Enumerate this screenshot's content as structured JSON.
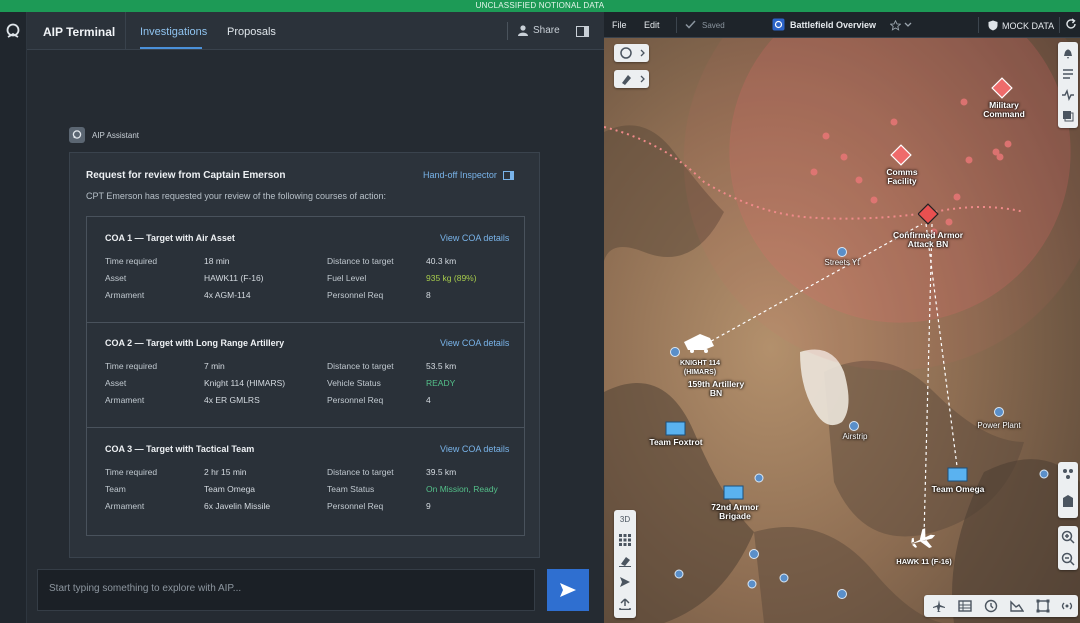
{
  "banner": "UNCLASSIFIED NOTIONAL DATA",
  "app": {
    "title": "AIP Terminal",
    "tabs": [
      "Investigations",
      "Proposals"
    ],
    "share": "Share"
  },
  "assistant": {
    "name": "AIP Assistant"
  },
  "request": {
    "title": "Request for review from Captain Emerson",
    "subtitle": "CPT Emerson has requested your review of the following courses of action:",
    "handoff": "Hand-off Inspector"
  },
  "coas": [
    {
      "title": "COA 1 — Target with Air Asset",
      "link": "View COA details",
      "rows": [
        [
          "Time required",
          "18 min",
          "Distance to target",
          "40.3 km"
        ],
        [
          "Asset",
          "HAWK11 (F-16)",
          "Fuel Level",
          "935 kg (89%)"
        ],
        [
          "Armament",
          "4x AGM-114",
          "Personnel Req",
          "8"
        ]
      ]
    },
    {
      "title": "COA 2 — Target with Long Range Artillery",
      "link": "View COA details",
      "rows": [
        [
          "Time required",
          "7 min",
          "Distance to target",
          "53.5 km"
        ],
        [
          "Asset",
          "Knight 114 (HIMARS)",
          "Vehicle Status",
          "READY"
        ],
        [
          "Armament",
          "4x ER GMLRS",
          "Personnel Req",
          "4"
        ]
      ]
    },
    {
      "title": "COA 3 — Target with Tactical Team",
      "link": "View COA details",
      "rows": [
        [
          "Time required",
          "2 hr 15 min",
          "Distance to target",
          "39.5 km"
        ],
        [
          "Team",
          "Team Omega",
          "Team Status",
          "On Mission, Ready"
        ],
        [
          "Armament",
          "6x Javelin Missile",
          "Personnel Req",
          "9"
        ]
      ]
    }
  ],
  "input": {
    "placeholder": "Start typing something to explore with AIP..."
  },
  "map": {
    "menu_file": "File",
    "menu_edit": "Edit",
    "saved": "Saved",
    "title": "Battlefield Overview",
    "mock": "MOCK DATA",
    "btn_3d": "3D",
    "labels": {
      "military_command": "Military Command",
      "comms": "Comms Facility",
      "armor": "Confirmed Armor Attack BN",
      "knight": "KNIGHT 114 (HIMARS)",
      "artillery": "159th Artillery BN",
      "foxtrot": "Team Foxtrot",
      "omega": "Team Omega",
      "armor72": "72nd Armor Brigade",
      "hawk": "HAWK 11 (F-16)",
      "airstrip": "Airstrip",
      "power": "Power Plant",
      "streets": "Streets Yt"
    }
  },
  "colors": {
    "accent": "#4a90d9",
    "link": "#79b4ea",
    "ready": "#54c08a",
    "fuel": "#a7cc4c",
    "banner": "#1d9a56",
    "threat": "#e8686a"
  }
}
